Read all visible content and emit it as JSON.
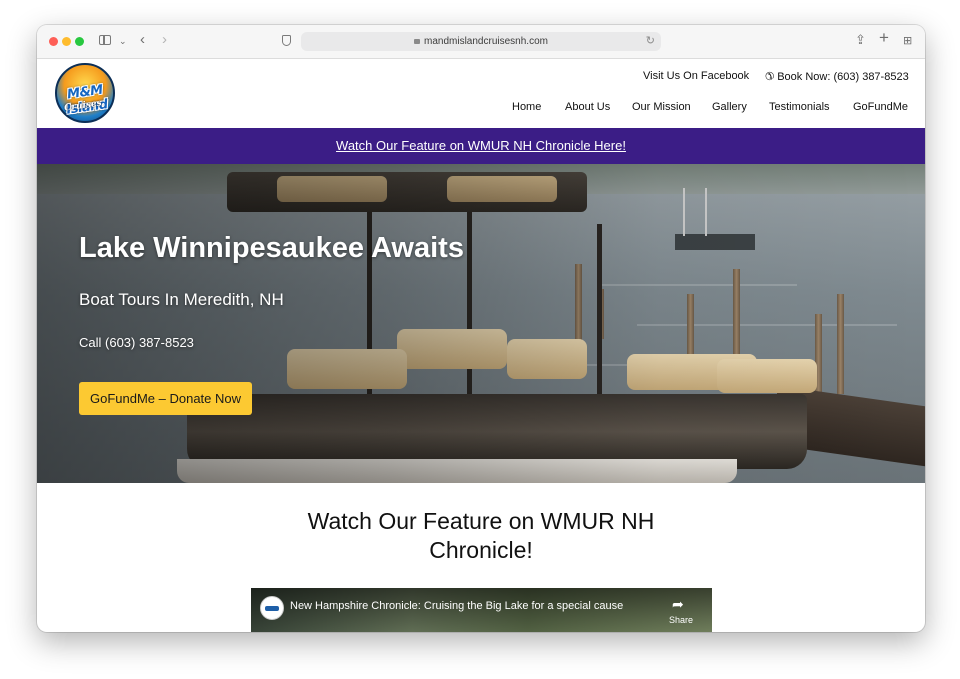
{
  "browser": {
    "url": "mandmislandcruisesnh.com"
  },
  "logo": {
    "text": "M&M Island",
    "sub": "Cruises"
  },
  "header": {
    "facebook_link": "Visit Us On Facebook",
    "book_now": "Book Now: (603) 387-8523",
    "nav": [
      "Home",
      "About Us",
      "Our Mission",
      "Gallery",
      "Testimonials",
      "GoFundMe"
    ]
  },
  "banner": {
    "link_text": "Watch Our Feature on WMUR NH Chronicle Here!",
    "background": "#3b1d86"
  },
  "hero": {
    "title": "Lake Winnipesaukee Awaits",
    "subtitle": "Boat Tours In Meredith, NH",
    "call": "Call (603) 387-8523",
    "button": "GoFundMe – Donate Now",
    "button_color": "#fcc932"
  },
  "feature": {
    "title": "Watch Our Feature on WMUR NH Chronicle!"
  },
  "video": {
    "title": "New Hampshire Chronicle: Cruising the Big Lake for a special cause",
    "share": "Share"
  }
}
